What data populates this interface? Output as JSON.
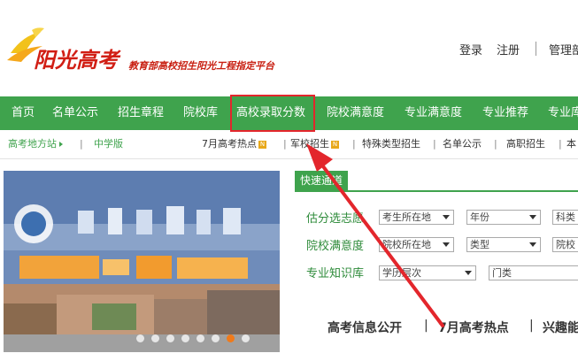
{
  "header": {
    "logo_text": "阳光高考",
    "slogan": "教育部高校招生阳光工程指定平台",
    "login": "登录",
    "register": "注册",
    "admin": "管理部"
  },
  "nav": {
    "items": [
      "首页",
      "名单公示",
      "招生章程",
      "院校库",
      "高校录取分数",
      "院校满意度",
      "专业满意度",
      "专业推荐",
      "专业库"
    ]
  },
  "subnav": {
    "left": [
      "高考地方站",
      "中学版"
    ],
    "right": [
      "7月高考热点",
      "军校招生",
      "特殊类型招生",
      "名单公示",
      "高职招生",
      "本"
    ],
    "hot_badge": "N"
  },
  "quick": {
    "tab": "快速通道",
    "rows": [
      {
        "label": "估分选志愿",
        "selects": [
          "考生所在地",
          "年份",
          "科类"
        ]
      },
      {
        "label": "院校满意度",
        "selects": [
          "院校所在地",
          "类型",
          "院校"
        ]
      },
      {
        "label": "专业知识库",
        "selects": [
          "学历层次",
          "门类"
        ]
      }
    ]
  },
  "info_bar": {
    "items": [
      "高考信息公开",
      "7月高考热点",
      "兴趣能"
    ],
    "separator": "|"
  },
  "colors": {
    "nav_green": "#3fa34d",
    "brand_red": "#d11e14",
    "annotation_red": "#e3262c"
  }
}
